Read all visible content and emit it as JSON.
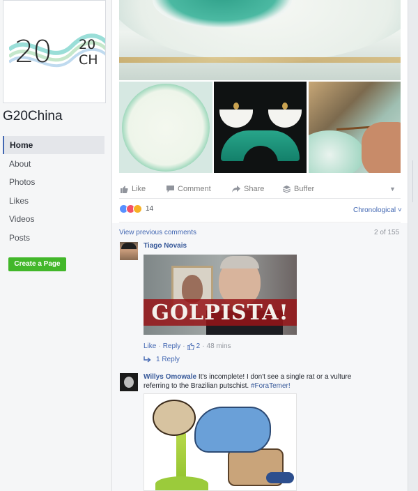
{
  "sidebar": {
    "logo": {
      "digits": "20",
      "small_text": "20\nCH",
      "lines": [
        "20",
        "CH"
      ]
    },
    "page_name": "G20China",
    "nav": [
      {
        "label": "Home",
        "active": true
      },
      {
        "label": "About",
        "active": false
      },
      {
        "label": "Photos",
        "active": false
      },
      {
        "label": "Likes",
        "active": false
      },
      {
        "label": "Videos",
        "active": false
      },
      {
        "label": "Posts",
        "active": false
      }
    ],
    "create_page_label": "Create a Page"
  },
  "post": {
    "actions": {
      "like": "Like",
      "comment": "Comment",
      "share": "Share",
      "buffer": "Buffer"
    },
    "reactions": {
      "count": "14"
    },
    "sort_label": "Chronological ˅",
    "view_previous": "View previous comments",
    "pager": "2 of 155"
  },
  "comments": [
    {
      "author": "Tiago Novais",
      "image_text": "GOLPISTA!",
      "like_label": "Like",
      "reply_label": "Reply",
      "likes": "2",
      "time": "48 mins",
      "replies_label": "1 Reply"
    },
    {
      "author": "Willys Omowale",
      "text": " It's incomplete! I don't see a single rat or a vulture referring to the Brazilian putschist. ",
      "hashtag": "#ForaTemer!"
    }
  ],
  "colors": {
    "link": "#4267b2",
    "create_button": "#42b72a",
    "page_bg": "#e9ebee"
  },
  "icons": [
    "thumb-up-icon",
    "comment-icon",
    "share-icon",
    "buffer-icon",
    "chevron-down-icon",
    "reply-arrow-icon"
  ]
}
